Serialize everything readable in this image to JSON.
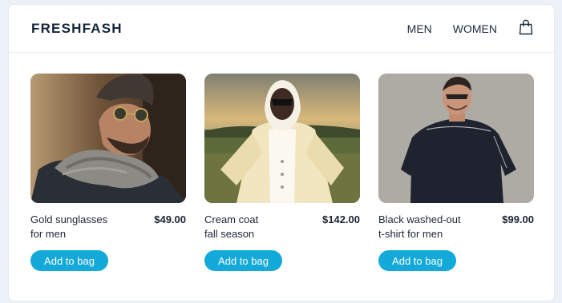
{
  "brand": "FRESHFASH",
  "nav": {
    "men": "MEN",
    "women": "WOMEN",
    "bag_icon": "shopping-bag-icon"
  },
  "products": [
    {
      "name_line1": "Gold sunglasses",
      "name_line2": "for men",
      "price": "$49.00",
      "button": "Add to bag"
    },
    {
      "name_line1": "Cream coat",
      "name_line2": "fall season",
      "price": "$142.00",
      "button": "Add to bag"
    },
    {
      "name_line1": "Black washed-out",
      "name_line2": "t-shirt for men",
      "price": "$99.00",
      "button": "Add to bag"
    }
  ],
  "colors": {
    "accent": "#13a9d9",
    "text": "#1c2536",
    "background": "#edf2f8"
  }
}
